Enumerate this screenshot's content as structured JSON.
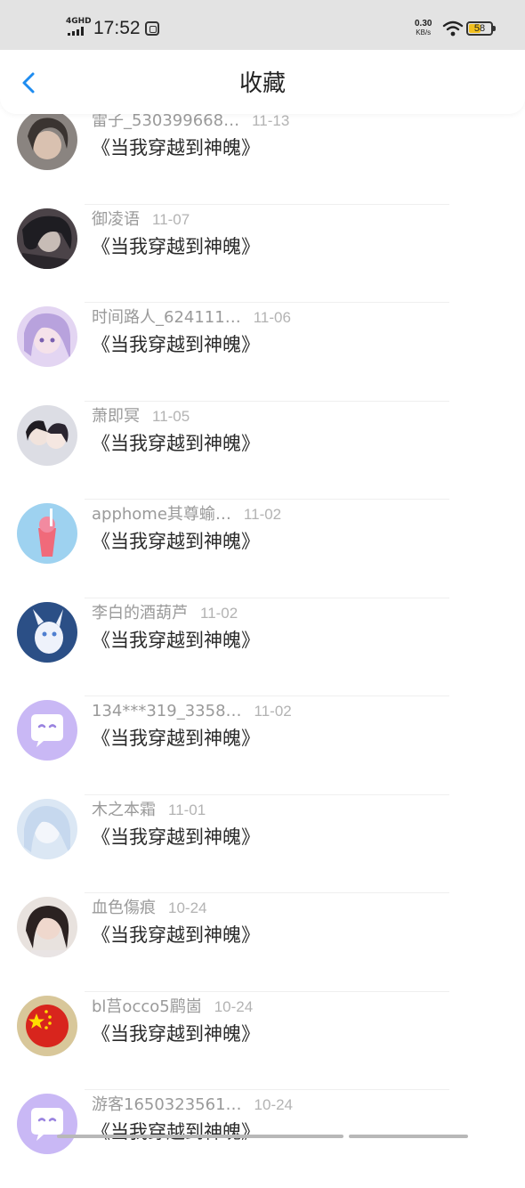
{
  "status_bar": {
    "network": "4GHD",
    "time": "17:52",
    "net_speed_value": "0.30",
    "net_speed_unit": "KB/s",
    "battery": "58",
    "battery_percent": 58
  },
  "header": {
    "back_icon": "chevron-left-icon",
    "title": "收藏"
  },
  "items": [
    {
      "user": "雷子_530399668…",
      "date": "11-13",
      "title": "《当我穿越到神魄》",
      "avatar": "girl-dark"
    },
    {
      "user": "御凌语",
      "date": "11-07",
      "title": "《当我穿越到神魄》",
      "avatar": "dark-hair"
    },
    {
      "user": "时间路人_624111…",
      "date": "11-06",
      "title": "《当我穿越到神魄》",
      "avatar": "anime-purple"
    },
    {
      "user": "萧即冥",
      "date": "11-05",
      "title": "《当我穿越到神魄》",
      "avatar": "anime-couple"
    },
    {
      "user": "apphome其尊蝓…",
      "date": "11-02",
      "title": "《当我穿越到神魄》",
      "avatar": "drink-blue"
    },
    {
      "user": "李白的酒葫芦",
      "date": "11-02",
      "title": "《当我穿越到神魄》",
      "avatar": "white-creature"
    },
    {
      "user": "134***319_3358…",
      "date": "11-02",
      "title": "《当我穿越到神魄》",
      "avatar": "default-purple"
    },
    {
      "user": "木之本霜",
      "date": "11-01",
      "title": "《当我穿越到神魄》",
      "avatar": "anime-white"
    },
    {
      "user": "血色傷痕",
      "date": "10-24",
      "title": "《当我穿越到神魄》",
      "avatar": "girl-photo"
    },
    {
      "user": "bl莒occo5鹛崮",
      "date": "10-24",
      "title": "《当我穿越到神魄》",
      "avatar": "flag-red"
    },
    {
      "user": "游客1650323561…",
      "date": "10-24",
      "title": "《当我穿越到神魄》",
      "avatar": "default-purple"
    }
  ],
  "colors": {
    "accent": "#1e8cf0",
    "default_avatar": "#c9b8f5",
    "status_bar_bg": "#e3e3e3",
    "battery_fill": "#f2c01e"
  }
}
